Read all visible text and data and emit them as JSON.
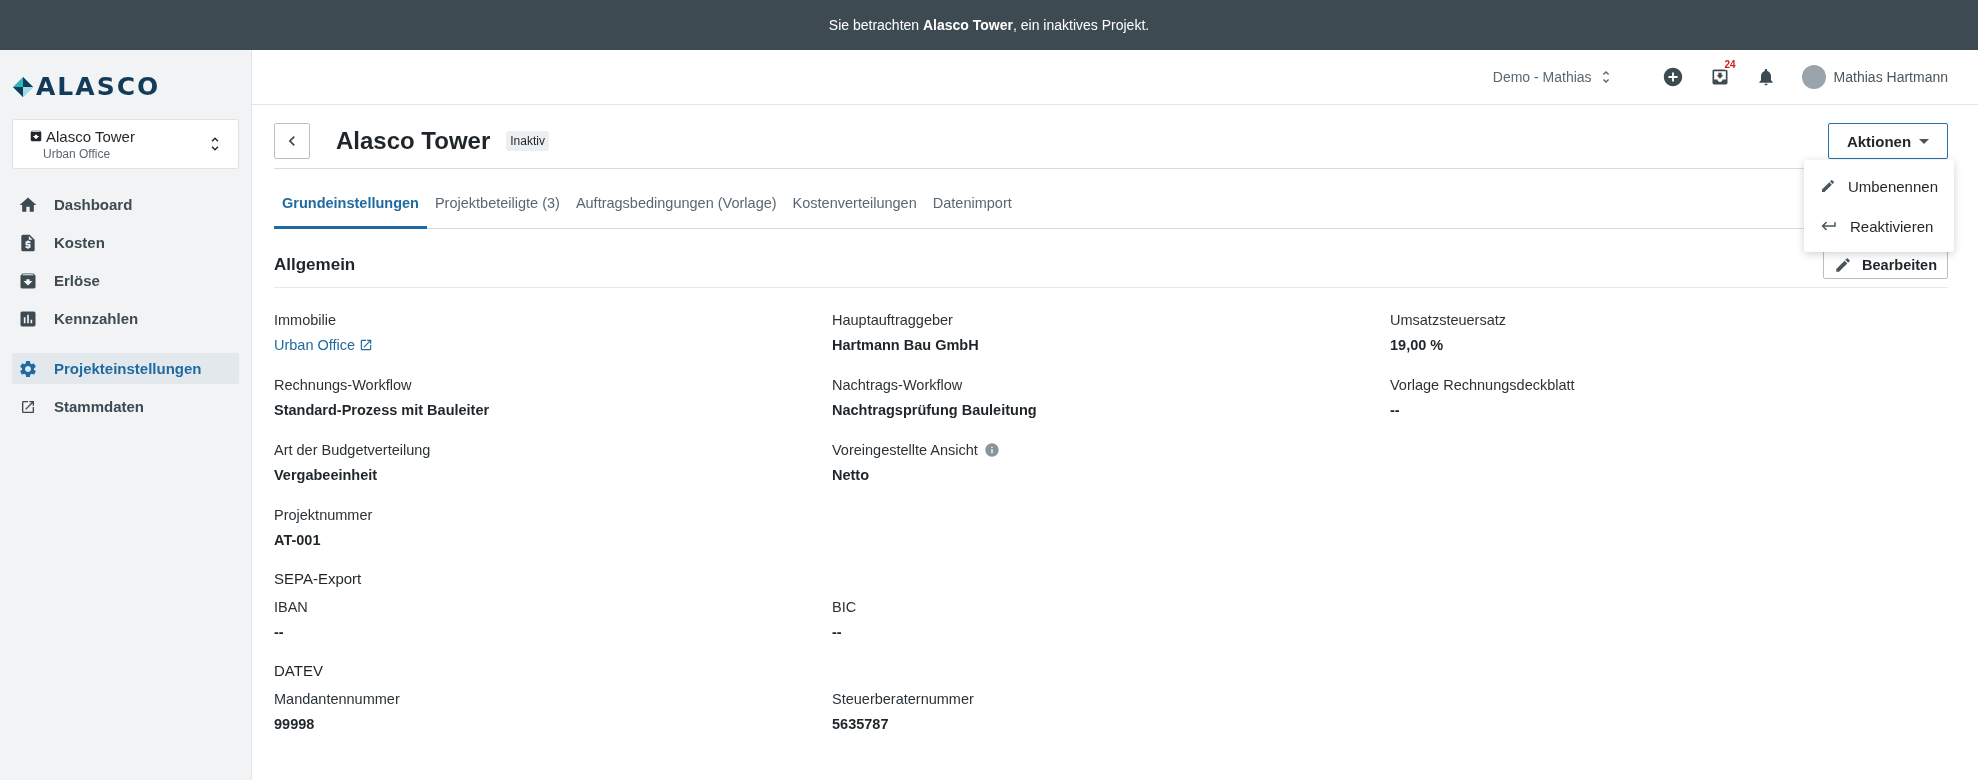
{
  "banner": {
    "text": "Sie betrachten **Alasco Tower**, ein inaktives Projekt."
  },
  "sidebar": {
    "logo": "ALASCO",
    "project": {
      "name": "Alasco Tower",
      "subtitle": "Urban Office"
    },
    "items": [
      {
        "label": "Dashboard",
        "selected": false
      },
      {
        "label": "Kosten",
        "selected": false
      },
      {
        "label": "Erlöse",
        "selected": false
      },
      {
        "label": "Kennzahlen",
        "selected": false
      }
    ],
    "settings_items": [
      {
        "label": "Projekteinstellungen",
        "selected": true
      },
      {
        "label": "Stammdaten",
        "selected": false
      }
    ]
  },
  "header": {
    "workspace": "Demo - Mathias",
    "inbox_count": "24",
    "user": "Mathias Hartmann"
  },
  "page": {
    "title": "Alasco Tower",
    "status": "Inaktiv",
    "actions_button": "Aktionen",
    "actions_menu": [
      {
        "label": "Umbenennen"
      },
      {
        "label": "Reaktivieren"
      }
    ],
    "tabs": [
      {
        "label": "Grundeinstellungen",
        "selected": true
      },
      {
        "label": "Projektbeteiligte (3)",
        "selected": false
      },
      {
        "label": "Auftragsbedingungen (Vorlage)",
        "selected": false
      },
      {
        "label": "Kostenverteilungen",
        "selected": false
      },
      {
        "label": "Datenimport",
        "selected": false
      }
    ],
    "section": {
      "title": "Allgemein",
      "edit_button": "Bearbeiten",
      "groups": [
        {
          "rows": [
            [
              {
                "label": "Immobilie",
                "value": "Urban Office",
                "kind": "link"
              },
              {
                "label": "Hauptauftraggeber",
                "value": "Hartmann Bau GmbH",
                "kind": "text"
              },
              {
                "label": "Umsatzsteuersatz",
                "value": "19,00 %",
                "kind": "text"
              }
            ],
            [
              {
                "label": "Rechnungs-Workflow",
                "value": "Standard-Prozess mit Bauleiter",
                "kind": "text"
              },
              {
                "label": "Nachtrags-Workflow",
                "value": "Nachtragsprüfung Bauleitung",
                "kind": "text"
              },
              {
                "label": "Vorlage Rechnungsdeckblatt",
                "value": "--",
                "kind": "text"
              }
            ],
            [
              {
                "label": "Art der Budgetverteilung",
                "value": "Vergabeeinheit",
                "kind": "text"
              },
              {
                "label": "Voreingestellte Ansicht",
                "value": "Netto",
                "kind": "info"
              }
            ],
            [
              {
                "label": "Projektnummer",
                "value": "AT-001",
                "kind": "text"
              }
            ]
          ]
        },
        {
          "heading": "SEPA-Export",
          "rows": [
            [
              {
                "label": "IBAN",
                "value": "--",
                "kind": "text"
              },
              {
                "label": "BIC",
                "value": "--",
                "kind": "text"
              }
            ]
          ]
        },
        {
          "heading": "DATEV",
          "rows": [
            [
              {
                "label": "Mandantennummer",
                "value": "99998",
                "kind": "text"
              },
              {
                "label": "Steuerberaternummer",
                "value": "5635787",
                "kind": "text"
              }
            ]
          ]
        }
      ]
    }
  }
}
